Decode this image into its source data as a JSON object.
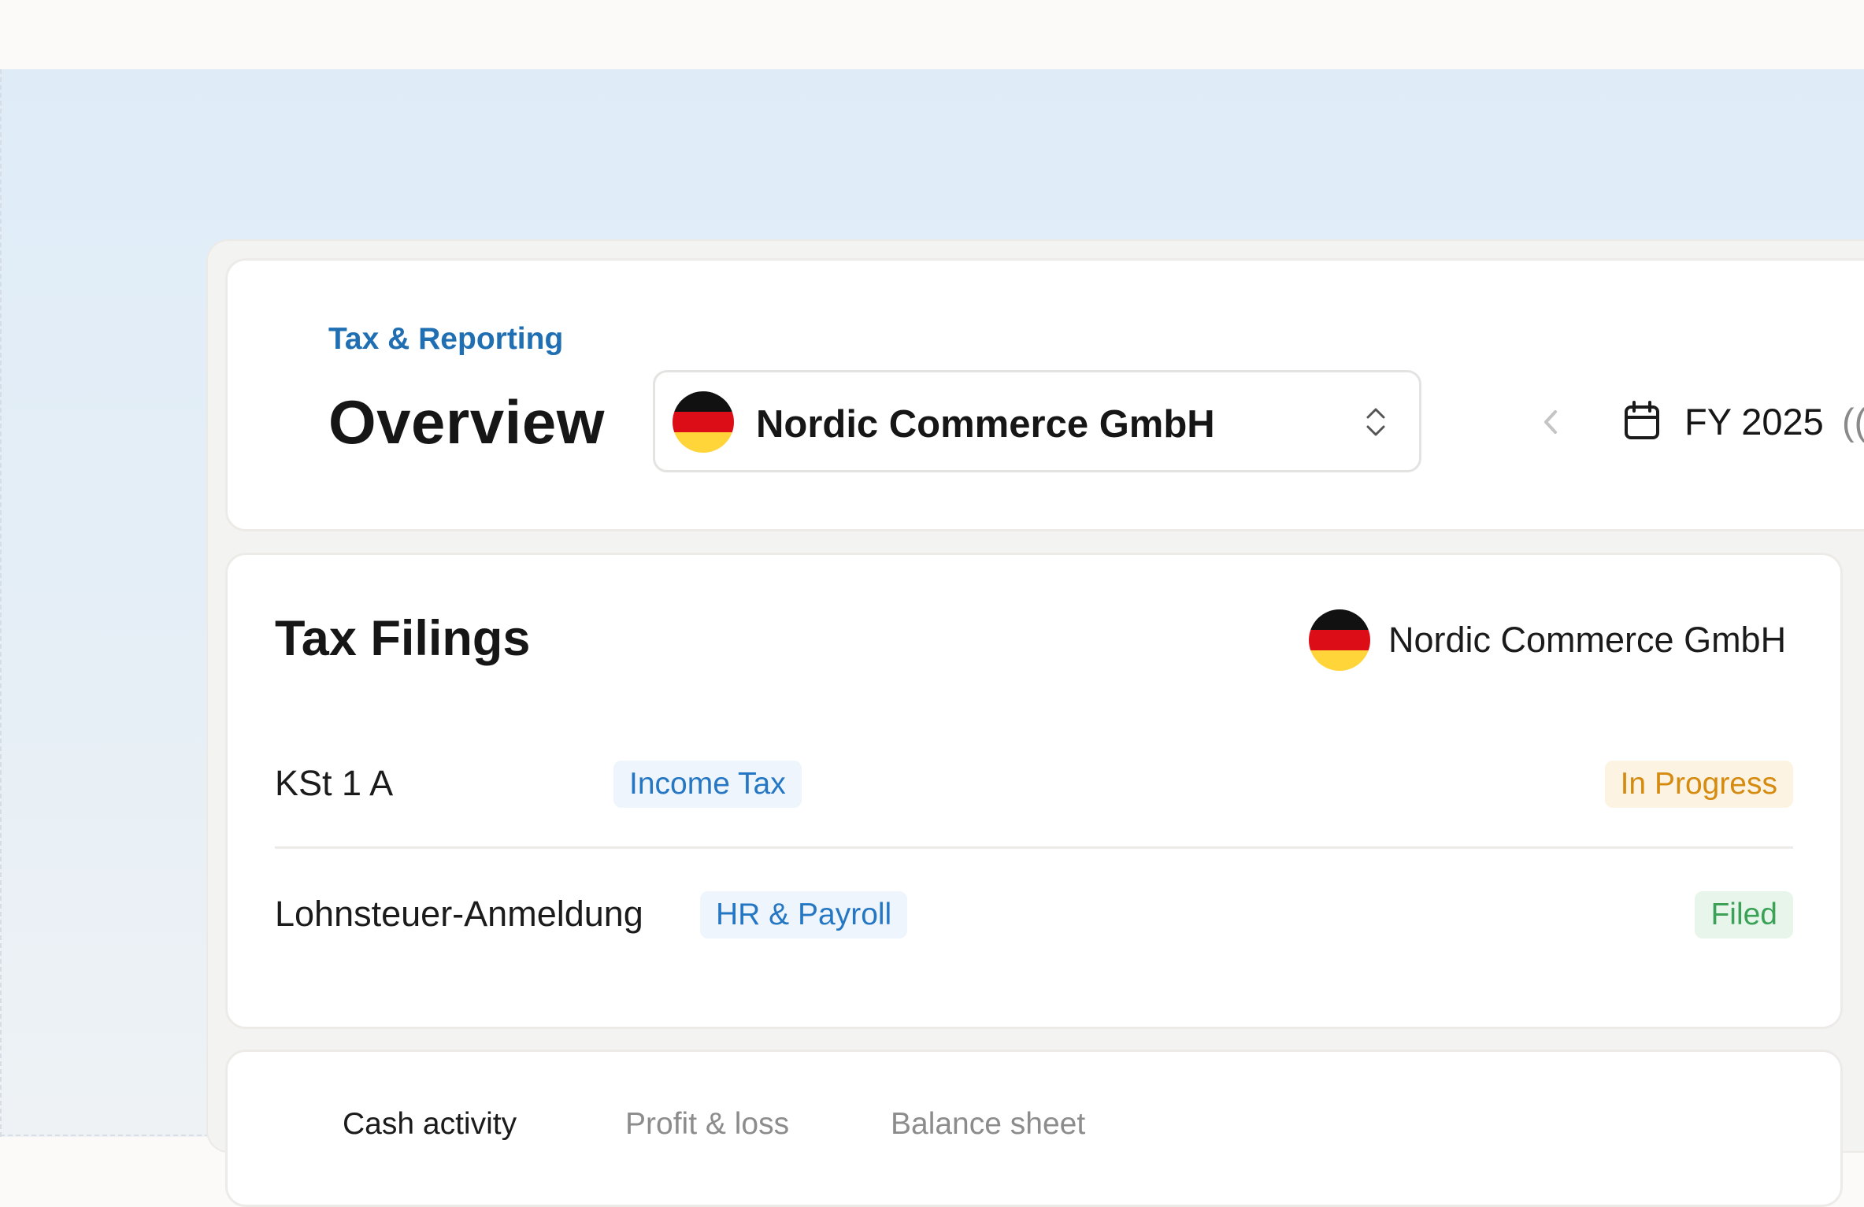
{
  "header": {
    "breadcrumb": "Tax & Reporting",
    "title": "Overview",
    "entity_selector": {
      "value": "Nordic Commerce GmbH",
      "flag": "germany-flag-icon"
    },
    "period": {
      "label": "FY 2025",
      "extra": "(("
    }
  },
  "tax_filings": {
    "title": "Tax Filings",
    "entity": "Nordic Commerce GmbH",
    "rows": [
      {
        "name": "KSt 1 A",
        "category": "Income Tax",
        "status": "In Progress"
      },
      {
        "name": "Lohnsteuer-Anmeldung",
        "category": "HR & Payroll",
        "status": "Filed"
      }
    ]
  },
  "reports": {
    "tabs": [
      {
        "label": "Cash activity",
        "active": true
      },
      {
        "label": "Profit & loss",
        "active": false
      },
      {
        "label": "Balance sheet",
        "active": false
      }
    ]
  },
  "colors": {
    "accent_blue": "#1f6fb2",
    "status_in_progress": "#d58a10",
    "status_filed": "#3aa157",
    "flag_black": "#111111",
    "flag_red": "#dd0d17",
    "flag_gold": "#ffd53a"
  }
}
